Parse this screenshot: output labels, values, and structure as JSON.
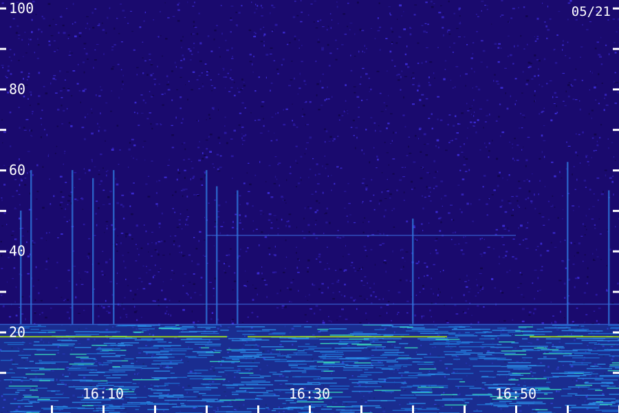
{
  "chart_data": {
    "type": "heatmap",
    "date_label": "05/21",
    "y_ticks": [
      {
        "value": 100,
        "label": "100"
      },
      {
        "value": 90,
        "label": ""
      },
      {
        "value": 80,
        "label": "80"
      },
      {
        "value": 70,
        "label": ""
      },
      {
        "value": 60,
        "label": "60"
      },
      {
        "value": 50,
        "label": ""
      },
      {
        "value": 40,
        "label": "40"
      },
      {
        "value": 30,
        "label": ""
      },
      {
        "value": 20,
        "label": "20"
      },
      {
        "value": 10,
        "label": ""
      }
    ],
    "x_ticks": [
      {
        "value": "16:05",
        "label": ""
      },
      {
        "value": "16:10",
        "label": "16:10"
      },
      {
        "value": "16:15",
        "label": ""
      },
      {
        "value": "16:20",
        "label": ""
      },
      {
        "value": "16:25",
        "label": ""
      },
      {
        "value": "16:30",
        "label": "16:30"
      },
      {
        "value": "16:35",
        "label": ""
      },
      {
        "value": "16:40",
        "label": ""
      },
      {
        "value": "16:45",
        "label": ""
      },
      {
        "value": "16:50",
        "label": "16:50"
      },
      {
        "value": "16:55",
        "label": ""
      },
      {
        "value": "17:00",
        "label": ""
      }
    ],
    "x_range": [
      "16:00",
      "17:00"
    ],
    "y_range": [
      0,
      102
    ],
    "colors": {
      "background": "#1a0a6e",
      "low_band": "#1e6fd0",
      "hot": "#39e0c0",
      "peak": "#b8f000",
      "tick": "#ffffff"
    },
    "vertical_bursts": [
      {
        "time": "16:02",
        "top": 50
      },
      {
        "time": "16:03",
        "top": 60
      },
      {
        "time": "16:07",
        "top": 60
      },
      {
        "time": "16:09",
        "top": 58
      },
      {
        "time": "16:11",
        "top": 60
      },
      {
        "time": "16:20",
        "top": 60
      },
      {
        "time": "16:21",
        "top": 56
      },
      {
        "time": "16:23",
        "top": 55
      },
      {
        "time": "16:40",
        "top": 48
      },
      {
        "time": "16:55",
        "top": 62
      },
      {
        "time": "16:59",
        "top": 55
      }
    ],
    "horizontal_lines": [
      {
        "y": 44,
        "from": "16:20",
        "to": "16:50"
      },
      {
        "y": 27,
        "from": "16:00",
        "to": "17:00"
      },
      {
        "y": 22,
        "from": "16:00",
        "to": "17:00"
      }
    ]
  }
}
